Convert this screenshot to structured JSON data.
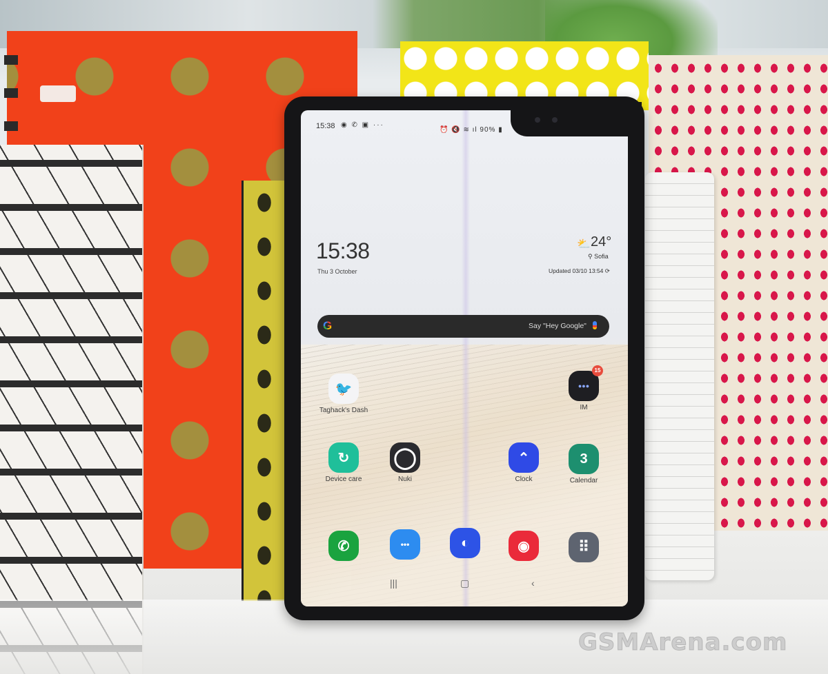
{
  "scene": {
    "description": "Product photo of a foldable smartphone standing open among colorful notebooks",
    "colors": {
      "orange_notebook": "#f1411a",
      "polka_dot": "#a38f3e",
      "red_dots": "#d8174a",
      "yellow_notebook": "#d2c43a",
      "phone_frame": "#151517"
    }
  },
  "status_bar": {
    "time": "15:38",
    "left_icons": [
      "chat-bubble-icon",
      "viber-icon",
      "gallery-icon",
      "more-dots-icon"
    ],
    "left_icons_glyphs": "◉ ✆ ▣ ···",
    "right_icons": [
      "alarm-icon",
      "mute-icon",
      "wifi-icon",
      "signal-icon",
      "battery-icon"
    ],
    "right_icons_glyphs": "⏰ 🔇 ≋ ıl",
    "battery": "90%"
  },
  "clock_widget": {
    "time": "15:38",
    "date": "Thu 3 October"
  },
  "weather_widget": {
    "icon": "partly-cloudy-icon",
    "icon_glyph": "⛅",
    "temperature": "24°",
    "location": "⚲ Sofia",
    "updated": "Updated 03/10 13:54 ⟳"
  },
  "search_bar": {
    "logo": "G",
    "hint": "Say \"Hey Google\""
  },
  "apps_row1": [
    {
      "label": "Taghack's Dash",
      "glyph": "🐦",
      "color": "#f4f4f6"
    },
    {
      "label": "IM",
      "glyph": "●●●",
      "color": "#1e1e22",
      "badge": "15"
    }
  ],
  "apps_row2": [
    {
      "label": "Device care",
      "glyph": "↻",
      "color": "#1fbf9a"
    },
    {
      "label": "Nuki",
      "glyph": "◯",
      "color": "#2a2a2e"
    },
    {
      "label": "Clock",
      "glyph": "⌃",
      "color": "#2f4ae6"
    },
    {
      "label": "Calendar",
      "glyph": "3",
      "color": "#1d8f6f"
    }
  ],
  "dock": [
    {
      "name": "phone",
      "glyph": "✆",
      "color": "#1aa33f"
    },
    {
      "name": "messages",
      "glyph": "•••",
      "color": "#2d8cf0"
    },
    {
      "name": "internet",
      "glyph": "◐",
      "color": "#2d53e6"
    },
    {
      "name": "camera",
      "glyph": "◉",
      "color": "#ea2a3a"
    },
    {
      "name": "apps",
      "glyph": "⠿",
      "color": "#5e6470"
    }
  ],
  "navbar": {
    "recents": "|||",
    "home": "▢",
    "back": "‹"
  },
  "watermark": "GSMArena.com"
}
